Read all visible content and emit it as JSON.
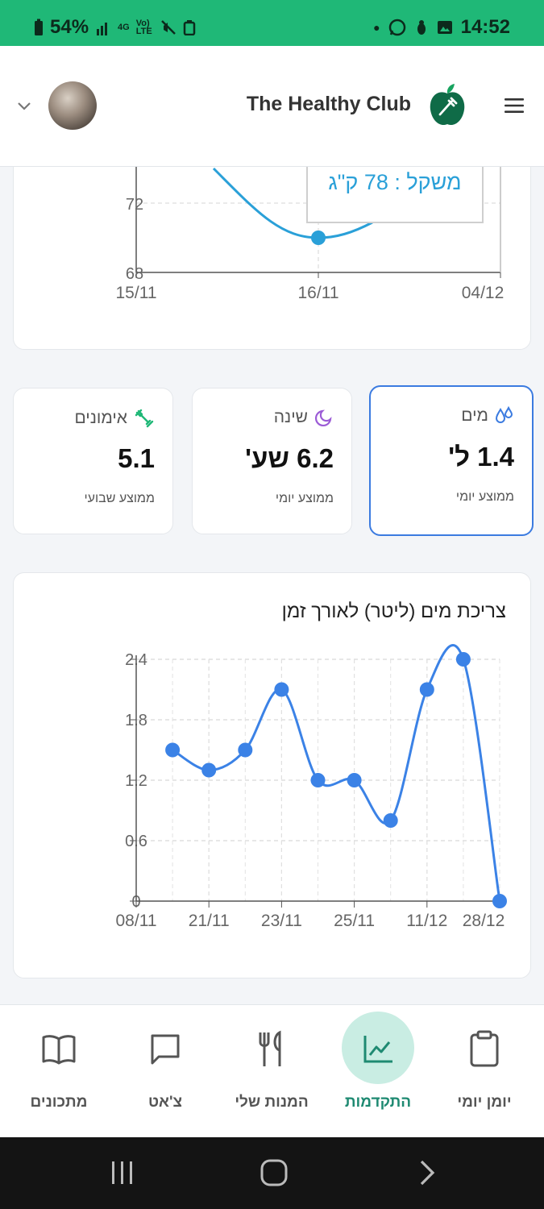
{
  "status_bar": {
    "battery": "54%",
    "network": "4G",
    "volte": "Vo) LTE",
    "time": "14:52"
  },
  "header": {
    "app_title": "The Healthy Club"
  },
  "weight_chart": {
    "tooltip": "משקל : 78 ק\"ג",
    "y_ticks": [
      "72",
      "68"
    ],
    "x_ticks": [
      "15/11",
      "16/11",
      "04/12"
    ]
  },
  "stats": {
    "water": {
      "title": "מים",
      "value": "1.4 ל'",
      "sub": "ממוצע יומי",
      "icon": "droplets-icon"
    },
    "sleep": {
      "title": "שינה",
      "value": "6.2 שע'",
      "sub": "ממוצע יומי",
      "icon": "moon-icon"
    },
    "workouts": {
      "title": "אימונים",
      "value": "5.1",
      "sub": "ממוצע שבועי",
      "icon": "dumbbell-icon"
    }
  },
  "chart_data": {
    "type": "line",
    "title": "צריכת מים (ליטר) לאורך זמן",
    "x_tick_labels": [
      "08/11",
      "21/11",
      "23/11",
      "25/11",
      "11/12",
      "28/12"
    ],
    "y_tick_labels": [
      "2.4",
      "1.8",
      "1.2",
      "0.6",
      "0"
    ],
    "ylim": [
      0,
      2.4
    ],
    "values": [
      1.5,
      1.3,
      1.5,
      2.1,
      1.2,
      1.2,
      0.8,
      2.1,
      2.4,
      0
    ],
    "grid": true
  },
  "nav": {
    "items": [
      {
        "label": "יומן יומי",
        "icon": "clipboard-icon"
      },
      {
        "label": "התקדמות",
        "icon": "chart-line-icon"
      },
      {
        "label": "המנות שלי",
        "icon": "utensils-icon"
      },
      {
        "label": "צ'אט",
        "icon": "chat-icon"
      },
      {
        "label": "מתכונים",
        "icon": "book-icon"
      }
    ]
  },
  "colors": {
    "brand_green": "#1fb877",
    "chart_blue": "#3b82e6",
    "weight_line": "#2aa0d8",
    "active_nav_bg": "#c9ede3",
    "active_nav_text": "#1f8a72"
  }
}
